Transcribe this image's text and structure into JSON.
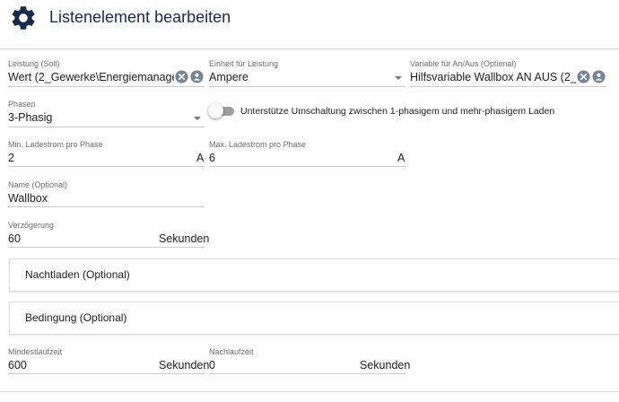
{
  "header": {
    "title": "Listenelement bearbeiten",
    "icon": "gear-icon",
    "icon_color": "#1a2a4a"
  },
  "fields": {
    "leistung": {
      "label": "Leistung (Soll)",
      "value": "Wert (2_Gewerke\\Energiemanagem"
    },
    "einheit": {
      "label": "Einheit für Leistung",
      "value": "Ampere"
    },
    "variable": {
      "label": "Variable für An/Aus (Optional)",
      "value": "Hilfsvariable Wallbox AN AUS (2_Ge"
    },
    "phasen": {
      "label": "Phasen",
      "value": "3-Phasig"
    },
    "umschaltung": {
      "label": "Unterstütze Umschaltung zwischen 1-phasigem und mehr-phasigem Laden",
      "checked": false
    },
    "min_ladestrom": {
      "label": "Min. Ladestrom pro Phase",
      "value": "2",
      "unit": "A"
    },
    "max_ladestrom": {
      "label": "Max. Ladestrom pro Phase",
      "value": "6",
      "unit": "A"
    },
    "name": {
      "label": "Name (Optional)",
      "value": "Wallbox"
    },
    "verzoegerung": {
      "label": "Verzögerung",
      "value": "60",
      "unit": "Sekunden"
    },
    "mindestlaufzeit": {
      "label": "Mindestlaufzeit",
      "value": "600",
      "unit": "Sekunden"
    },
    "nachlaufzeit": {
      "label": "Nachlaufzeit",
      "value": "0",
      "unit": "Sekunden"
    }
  },
  "panels": {
    "nachtladen": "Nachtladen (Optional)",
    "bedingung": "Bedingung (Optional)"
  }
}
